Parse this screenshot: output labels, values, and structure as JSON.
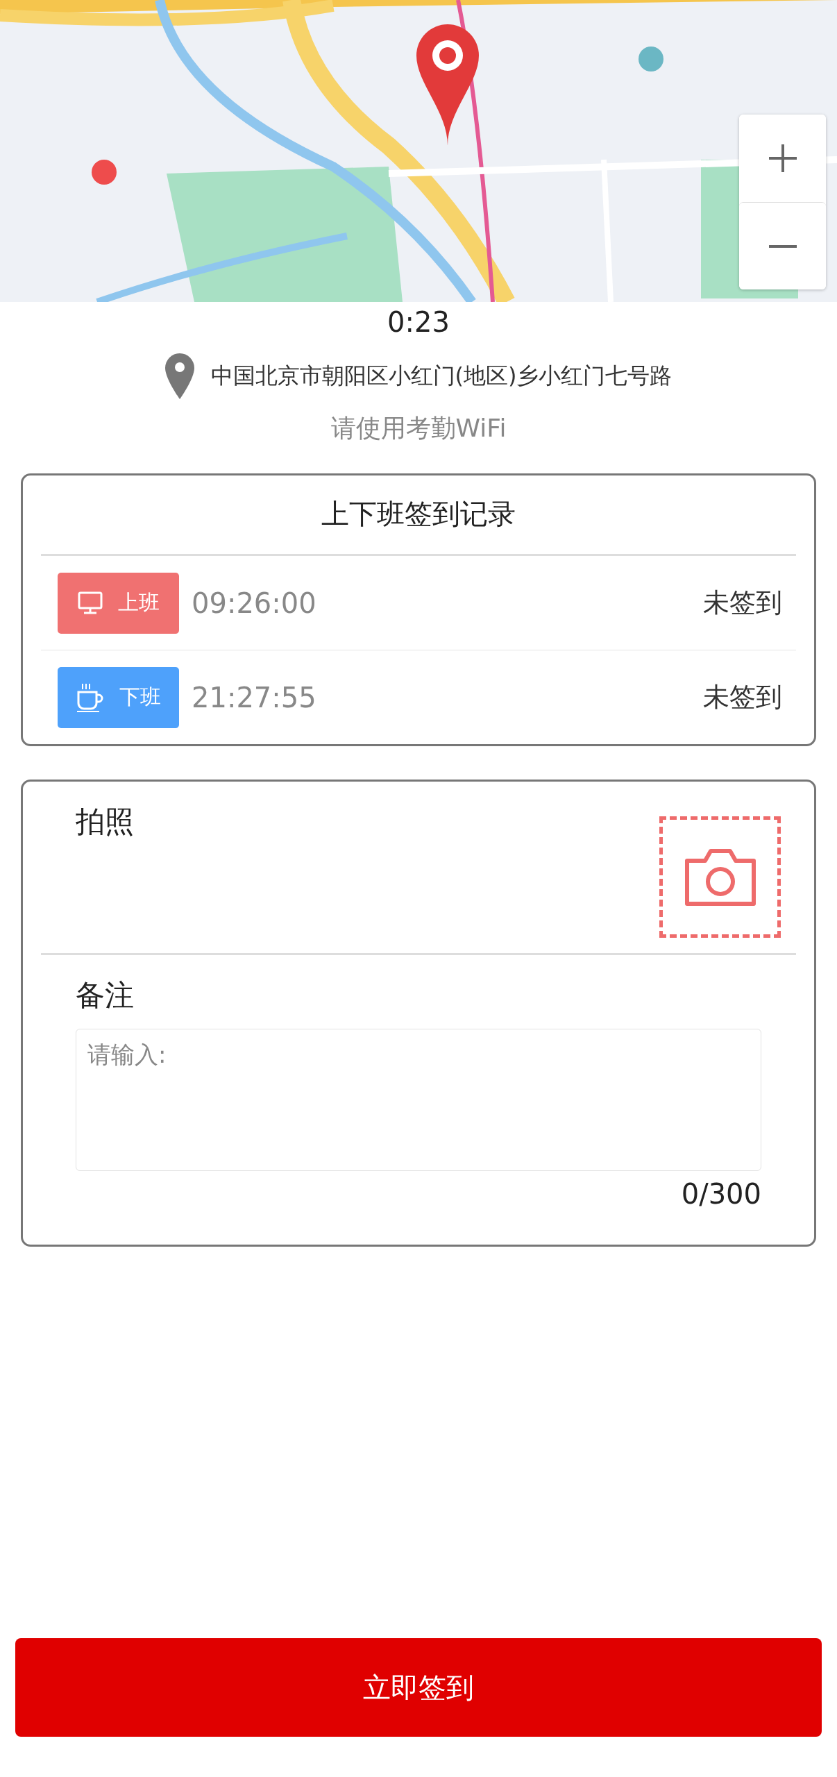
{
  "timer": "0:23",
  "address": "中国北京市朝阳区小红门(地区)乡小红门七号路",
  "wifi_hint": "请使用考勤WiFi",
  "records": {
    "title": "上下班签到记录",
    "items": [
      {
        "kind": "work",
        "label": "上班",
        "color": "#f07171",
        "time": "09:26:00",
        "status": "未签到"
      },
      {
        "kind": "rest",
        "label": "下班",
        "color": "#4ea1fb",
        "time": "21:27:55",
        "status": "未签到"
      }
    ]
  },
  "photo": {
    "label": "拍照"
  },
  "remark": {
    "label": "备注",
    "placeholder": "请输入:",
    "counter": "0/300"
  },
  "submit": "立即签到"
}
